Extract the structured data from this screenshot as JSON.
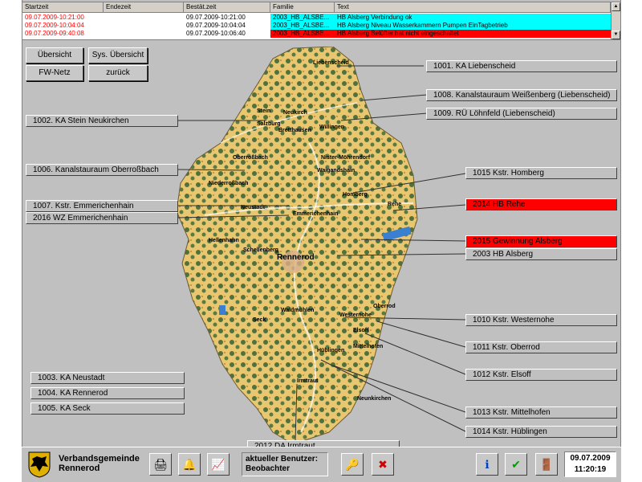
{
  "alarm_list": {
    "columns": [
      "Startzeit",
      "Endezeit",
      "Bestät.zeit",
      "Familie",
      "Text"
    ],
    "rows": [
      {
        "start": "09.07.2009-10:21:00",
        "end": "",
        "ack": "09.07.2009-10:21:00",
        "family": "2003_HB_ALSBE...",
        "text": "HB Alsberg Verbindung ok",
        "bg": "#00ffff",
        "start_color": "#ff0000"
      },
      {
        "start": "09.07.2009-10:04:04",
        "end": "",
        "ack": "09.07.2009-10:04:04",
        "family": "2003_HB_ALSBE...",
        "text": "HB Alsberg Niveau Wasserkammern Pumpen EinTagbetrieb",
        "bg": "#00ffff",
        "start_color": "#ff0000"
      },
      {
        "start": "09.07.2009-09:40:08",
        "end": "",
        "ack": "09.07.2009-10:06:40",
        "family": "2003_HB_ALSBE...",
        "text": "HB Alsberg Belüfter hat nicht eingeschaltet",
        "bg": "#ff0000",
        "start_color": "#ff0000"
      }
    ]
  },
  "nav": {
    "overview": "Übersicht",
    "sys_overview": "Sys. Übersicht",
    "fw_net": "FW-Netz",
    "back": "zurück"
  },
  "map": {
    "places": [
      "Liebenscheid",
      "Stein",
      "Neukirch",
      "Salzburg",
      "Bretthausen",
      "Willingen",
      "Oberroßbach",
      "Nister-Möhrendorf",
      "Waigandshain",
      "Niederroßbach",
      "Homberg",
      "Emmerichenhain",
      "Neustadt",
      "Rehe",
      "Hellenhahn",
      "Schellenberg",
      "Rennerod",
      "Seck",
      "Waldmühlen",
      "Oberrod",
      "Westernohe",
      "Elsoff",
      "Mittelhofen",
      "Hüblingen",
      "Irmtraut",
      "Neunkirchen"
    ]
  },
  "stations": [
    {
      "label": "1001. KA Liebenscheid",
      "red": false
    },
    {
      "label": "1008. Kanalstauraum Weißenberg (Liebenscheid)",
      "red": false
    },
    {
      "label": "1009. RÜ Löhnfeld (Liebenscheid)",
      "red": false
    },
    {
      "label": "1002. KA Stein Neukirchen",
      "red": false
    },
    {
      "label": "1006. Kanalstauraum Oberroßbach",
      "red": false
    },
    {
      "label": "1015  Kstr. Homberg",
      "red": false
    },
    {
      "label": "1007. Kstr. Emmerichenhain",
      "red": false
    },
    {
      "label": "2016 WZ Emmerichenhain",
      "red": false
    },
    {
      "label": "2014  HB Rehe",
      "red": true
    },
    {
      "label": "2015 Gewinnung  Alsberg",
      "red": true
    },
    {
      "label": "2003 HB Alsberg",
      "red": false
    },
    {
      "label": "1010  Kstr. Westernohe",
      "red": false
    },
    {
      "label": "1011  Kstr. Oberrod",
      "red": false
    },
    {
      "label": "1012  Kstr. Elsoff",
      "red": false
    },
    {
      "label": "1003. KA Neustadt",
      "red": false
    },
    {
      "label": "1004. KA Rennerod",
      "red": false
    },
    {
      "label": "1005. KA Seck",
      "red": false
    },
    {
      "label": "1013  Kstr. Mittelhofen",
      "red": false
    },
    {
      "label": "1014  Kstr. Hüblingen",
      "red": false
    },
    {
      "label": "2012  DA Irmtraut",
      "red": false
    }
  ],
  "footer": {
    "org_line1": "Verbandsgemeinde",
    "org_line2": "Rennerod",
    "user_label": "aktueller Benutzer:",
    "user_name": "Beobachter",
    "date": "09.07.2009",
    "time": "11:20:19"
  },
  "colors": {
    "map_fill": "#e9c770",
    "map_forest": "#4d6a3a",
    "alarm_red": "#ff0000",
    "alarm_cyan": "#00ffff"
  }
}
